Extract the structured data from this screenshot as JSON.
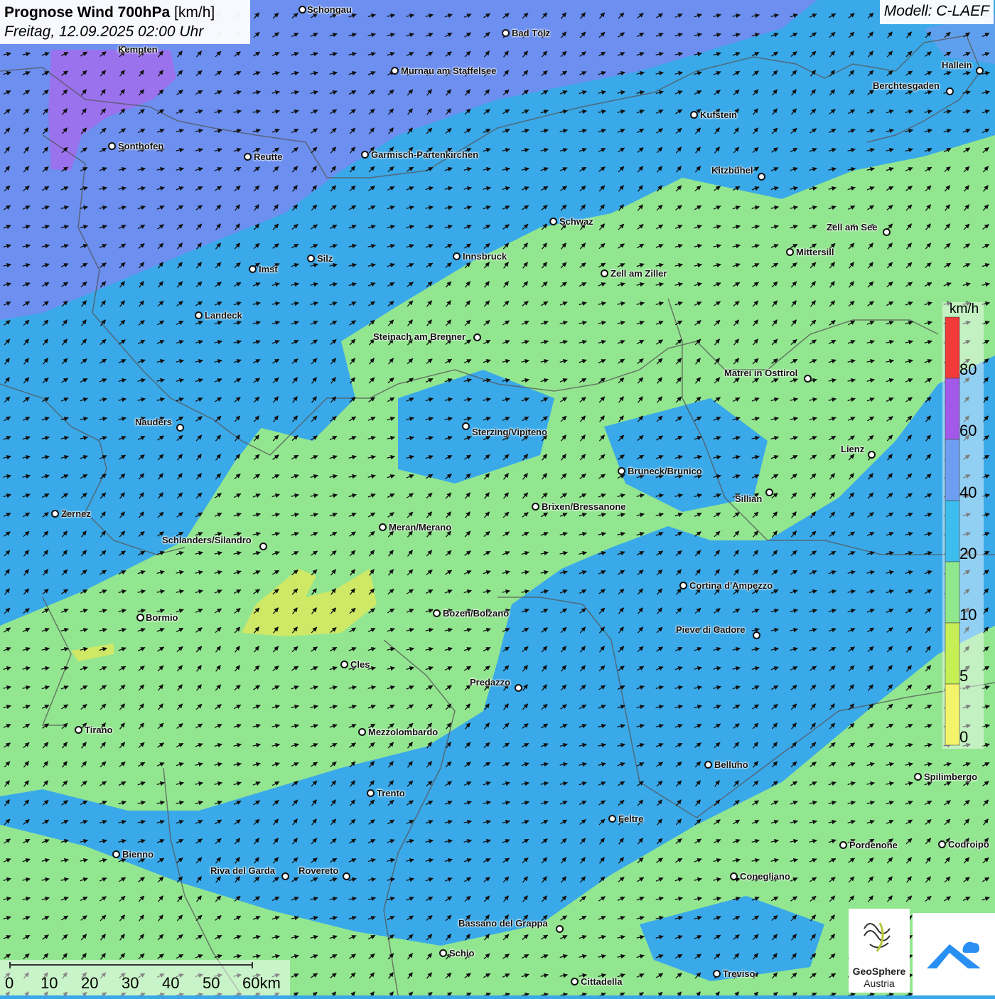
{
  "title": {
    "main": "Prognose Wind 700hPa",
    "unit": "[km/h]",
    "datetime": "Freitag, 12.09.2025 02:00 Uhr"
  },
  "model": "Modell: C-LAEF",
  "cities": [
    {
      "name": "Schongau"
    },
    {
      "name": "Bad Tölz"
    },
    {
      "name": "Kempten"
    },
    {
      "name": "Murnau am Staffelsee"
    },
    {
      "name": "Hallein"
    },
    {
      "name": "Berchtesgaden"
    },
    {
      "name": "Kufstein"
    },
    {
      "name": "Sonthofen"
    },
    {
      "name": "Reutte"
    },
    {
      "name": "Garmisch-Partenkirchen"
    },
    {
      "name": "Kitzbühel"
    },
    {
      "name": "Schwaz"
    },
    {
      "name": "Zell am See"
    },
    {
      "name": "Mittersill"
    },
    {
      "name": "Innsbruck"
    },
    {
      "name": "Imst"
    },
    {
      "name": "Silz"
    },
    {
      "name": "Zell am Ziller"
    },
    {
      "name": "Landeck"
    },
    {
      "name": "Steinach am Brenner"
    },
    {
      "name": "Matrei in Osttirol"
    },
    {
      "name": "Nauders"
    },
    {
      "name": "Sterzing/Vipiteno"
    },
    {
      "name": "Lienz"
    },
    {
      "name": "Bruneck/Brunico"
    },
    {
      "name": "Sillian"
    },
    {
      "name": "Zernez"
    },
    {
      "name": "Brixen/Bressanone"
    },
    {
      "name": "Meran/Merano"
    },
    {
      "name": "Schlanders/Silandro"
    },
    {
      "name": "Cortina d'Ampezzo"
    },
    {
      "name": "Bozen/Bolzano"
    },
    {
      "name": "Bormio"
    },
    {
      "name": "Pieve di Cadore"
    },
    {
      "name": "Cles"
    },
    {
      "name": "Predazzo"
    },
    {
      "name": "Tirano"
    },
    {
      "name": "Mezzolombardo"
    },
    {
      "name": "Belluno"
    },
    {
      "name": "Spilimbergo"
    },
    {
      "name": "Trento"
    },
    {
      "name": "Feltre"
    },
    {
      "name": "Pordenone"
    },
    {
      "name": "Codroipo"
    },
    {
      "name": "Bienno"
    },
    {
      "name": "Riva del Garda"
    },
    {
      "name": "Rovereto"
    },
    {
      "name": "Conegliano"
    },
    {
      "name": "Bassano del Grappa"
    },
    {
      "name": "Schio"
    },
    {
      "name": "Treviso"
    },
    {
      "name": "Cittadella"
    }
  ],
  "legend": {
    "unit": "km/h",
    "labels": [
      "80",
      "60",
      "40",
      "20",
      "10",
      "5",
      "0"
    ],
    "colors": [
      "#f23a3a",
      "#a259ea",
      "#6d9ef2",
      "#3cbdee",
      "#8fe88c",
      "#c5ef55",
      "#f4f46a"
    ]
  },
  "scale_bar": {
    "labels": [
      "0",
      "10",
      "20",
      "30",
      "40",
      "50",
      "60km"
    ]
  },
  "logos": {
    "geosphere_line1": "GeoSphere",
    "geosphere_line2": "Austria"
  },
  "colors": {
    "zone_violet": "#9a77f0",
    "zone_blue": "#6e95f0",
    "zone_cyan": "#3cb0ea",
    "zone_green": "#96e896",
    "zone_yellow": "#cfe866",
    "arrow": "#111111"
  }
}
